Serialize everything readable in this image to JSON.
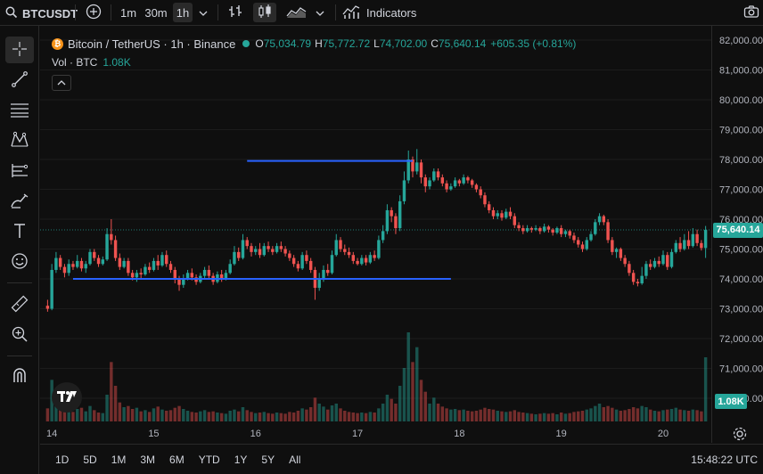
{
  "toolbar": {
    "symbol": "BTCUSDT",
    "intervals": [
      "1m",
      "30m",
      "1h"
    ],
    "active_interval": "1h",
    "indicators_label": "Indicators"
  },
  "legend": {
    "title": "Bitcoin / TetherUS · 1h · Binance",
    "coin_glyph": "₿",
    "o_label": "O",
    "o_value": "75,034.79",
    "h_label": "H",
    "h_value": "75,772.72",
    "l_label": "L",
    "l_value": "74,702.00",
    "c_label": "C",
    "c_value": "75,640.14",
    "change": "+605.35 (+0.81%)",
    "volume_label": "Vol · BTC",
    "volume_value": "1.08K"
  },
  "price_axis": {
    "ticks": [
      "82,000.00",
      "81,000.00",
      "80,000.00",
      "79,000.00",
      "78,000.00",
      "77,000.00",
      "76,000.00",
      "75,000.00",
      "74,000.00",
      "73,000.00",
      "72,000.00",
      "71,000.00",
      "70,000.00"
    ],
    "current_price_tag": "75,640.14",
    "volume_tag": "1.08K"
  },
  "time_axis": {
    "labels": [
      "14",
      "15",
      "16",
      "17",
      "18",
      "19",
      "20"
    ]
  },
  "bottom": {
    "ranges": [
      "1D",
      "5D",
      "1M",
      "3M",
      "6M",
      "YTD",
      "1Y",
      "5Y",
      "All"
    ],
    "clock": "15:48:22 UTC"
  },
  "icons": {
    "sidebar": [
      "crosshair-icon",
      "trend-line-icon",
      "fib-retracement-icon",
      "pattern-icon",
      "prediction-icon",
      "brush-icon",
      "text-icon",
      "emoji-icon",
      "ruler-icon",
      "zoom-in-icon",
      "magnet-icon"
    ]
  },
  "colors": {
    "up": "#26a69a",
    "down": "#ef5350",
    "drawn_line": "#2962ff",
    "background": "#0f0f0f"
  },
  "chart_data": {
    "type": "candlestick",
    "symbol": "BTCUSDT",
    "timeframe": "1h",
    "ylim": [
      69800,
      82300
    ],
    "x_day_labels": [
      "14",
      "15",
      "16",
      "17",
      "18",
      "19",
      "20"
    ],
    "candles": [
      {
        "o": 73100,
        "c": 73000,
        "h": 73300,
        "l": 72900,
        "v": 220
      },
      {
        "o": 73000,
        "c": 74300,
        "h": 74500,
        "l": 72950,
        "v": 700
      },
      {
        "o": 74300,
        "c": 74700,
        "h": 74900,
        "l": 74200,
        "v": 300
      },
      {
        "o": 74700,
        "c": 74400,
        "h": 74800,
        "l": 74300,
        "v": 250
      },
      {
        "o": 74400,
        "c": 74200,
        "h": 74500,
        "l": 74050,
        "v": 200
      },
      {
        "o": 74200,
        "c": 74500,
        "h": 74650,
        "l": 74100,
        "v": 180
      },
      {
        "o": 74500,
        "c": 74400,
        "h": 74600,
        "l": 74300,
        "v": 160
      },
      {
        "o": 74400,
        "c": 74600,
        "h": 74800,
        "l": 74350,
        "v": 210
      },
      {
        "o": 74600,
        "c": 74350,
        "h": 74700,
        "l": 74250,
        "v": 230
      },
      {
        "o": 74350,
        "c": 74500,
        "h": 74600,
        "l": 74200,
        "v": 170
      },
      {
        "o": 74500,
        "c": 74900,
        "h": 75000,
        "l": 74450,
        "v": 260
      },
      {
        "o": 74900,
        "c": 74700,
        "h": 75000,
        "l": 74600,
        "v": 190
      },
      {
        "o": 74700,
        "c": 74500,
        "h": 74800,
        "l": 74400,
        "v": 150
      },
      {
        "o": 74500,
        "c": 74650,
        "h": 74750,
        "l": 74450,
        "v": 140
      },
      {
        "o": 74650,
        "c": 75500,
        "h": 75700,
        "l": 74600,
        "v": 450
      },
      {
        "o": 75500,
        "c": 75300,
        "h": 76000,
        "l": 75150,
        "v": 1000
      },
      {
        "o": 75300,
        "c": 74700,
        "h": 75450,
        "l": 74600,
        "v": 600
      },
      {
        "o": 74700,
        "c": 74400,
        "h": 74850,
        "l": 74300,
        "v": 320
      },
      {
        "o": 74400,
        "c": 74600,
        "h": 74700,
        "l": 74350,
        "v": 240
      },
      {
        "o": 74600,
        "c": 74200,
        "h": 74700,
        "l": 74100,
        "v": 260
      },
      {
        "o": 74200,
        "c": 74050,
        "h": 74300,
        "l": 73950,
        "v": 210
      },
      {
        "o": 74050,
        "c": 74200,
        "h": 74300,
        "l": 73900,
        "v": 230
      },
      {
        "o": 74200,
        "c": 74150,
        "h": 74350,
        "l": 74000,
        "v": 170
      },
      {
        "o": 74150,
        "c": 74400,
        "h": 74500,
        "l": 74100,
        "v": 190
      },
      {
        "o": 74400,
        "c": 74300,
        "h": 74550,
        "l": 74200,
        "v": 160
      },
      {
        "o": 74300,
        "c": 74600,
        "h": 74700,
        "l": 74250,
        "v": 220
      },
      {
        "o": 74600,
        "c": 74450,
        "h": 74800,
        "l": 74300,
        "v": 250
      },
      {
        "o": 74450,
        "c": 74800,
        "h": 74900,
        "l": 74400,
        "v": 200
      },
      {
        "o": 74800,
        "c": 74500,
        "h": 74950,
        "l": 74400,
        "v": 180
      },
      {
        "o": 74500,
        "c": 74300,
        "h": 74600,
        "l": 74200,
        "v": 190
      },
      {
        "o": 74300,
        "c": 74000,
        "h": 74400,
        "l": 73850,
        "v": 230
      },
      {
        "o": 74000,
        "c": 73800,
        "h": 74100,
        "l": 73600,
        "v": 260
      },
      {
        "o": 73800,
        "c": 74000,
        "h": 74150,
        "l": 73700,
        "v": 210
      },
      {
        "o": 74000,
        "c": 74200,
        "h": 74300,
        "l": 73950,
        "v": 180
      },
      {
        "o": 74200,
        "c": 74050,
        "h": 74350,
        "l": 73950,
        "v": 160
      },
      {
        "o": 74050,
        "c": 73900,
        "h": 74150,
        "l": 73800,
        "v": 150
      },
      {
        "o": 73900,
        "c": 74100,
        "h": 74200,
        "l": 73850,
        "v": 170
      },
      {
        "o": 74100,
        "c": 74300,
        "h": 74400,
        "l": 74000,
        "v": 190
      },
      {
        "o": 74300,
        "c": 74100,
        "h": 74450,
        "l": 74000,
        "v": 160
      },
      {
        "o": 74100,
        "c": 73900,
        "h": 74200,
        "l": 73800,
        "v": 170
      },
      {
        "o": 73900,
        "c": 74150,
        "h": 74250,
        "l": 73850,
        "v": 150
      },
      {
        "o": 74150,
        "c": 74000,
        "h": 74300,
        "l": 73900,
        "v": 140
      },
      {
        "o": 74000,
        "c": 74200,
        "h": 74300,
        "l": 73950,
        "v": 130
      },
      {
        "o": 74200,
        "c": 74500,
        "h": 74650,
        "l": 74150,
        "v": 180
      },
      {
        "o": 74500,
        "c": 74900,
        "h": 75100,
        "l": 74450,
        "v": 200
      },
      {
        "o": 74900,
        "c": 74700,
        "h": 75050,
        "l": 74600,
        "v": 170
      },
      {
        "o": 74700,
        "c": 75300,
        "h": 75500,
        "l": 74650,
        "v": 240
      },
      {
        "o": 75300,
        "c": 75100,
        "h": 75400,
        "l": 75000,
        "v": 190
      },
      {
        "o": 75100,
        "c": 74900,
        "h": 75200,
        "l": 74750,
        "v": 160
      },
      {
        "o": 74900,
        "c": 75000,
        "h": 75100,
        "l": 74800,
        "v": 140
      },
      {
        "o": 75000,
        "c": 74800,
        "h": 75200,
        "l": 74700,
        "v": 150
      },
      {
        "o": 74800,
        "c": 75100,
        "h": 75200,
        "l": 74750,
        "v": 160
      },
      {
        "o": 75100,
        "c": 75000,
        "h": 75250,
        "l": 74900,
        "v": 140
      },
      {
        "o": 75000,
        "c": 74900,
        "h": 75100,
        "l": 74800,
        "v": 130
      },
      {
        "o": 74900,
        "c": 75100,
        "h": 75200,
        "l": 74850,
        "v": 150
      },
      {
        "o": 75100,
        "c": 75000,
        "h": 75250,
        "l": 74900,
        "v": 140
      },
      {
        "o": 75000,
        "c": 74850,
        "h": 75100,
        "l": 74750,
        "v": 130
      },
      {
        "o": 74850,
        "c": 74700,
        "h": 74950,
        "l": 74600,
        "v": 160
      },
      {
        "o": 74700,
        "c": 74500,
        "h": 74800,
        "l": 74400,
        "v": 150
      },
      {
        "o": 74500,
        "c": 74350,
        "h": 74600,
        "l": 74250,
        "v": 180
      },
      {
        "o": 74350,
        "c": 74800,
        "h": 74900,
        "l": 74300,
        "v": 220
      },
      {
        "o": 74800,
        "c": 74600,
        "h": 74950,
        "l": 74500,
        "v": 200
      },
      {
        "o": 74600,
        "c": 74300,
        "h": 74700,
        "l": 74200,
        "v": 240
      },
      {
        "o": 74300,
        "c": 73700,
        "h": 74400,
        "l": 73300,
        "v": 400
      },
      {
        "o": 73700,
        "c": 74000,
        "h": 74200,
        "l": 73600,
        "v": 300
      },
      {
        "o": 74000,
        "c": 74300,
        "h": 74450,
        "l": 73900,
        "v": 250
      },
      {
        "o": 74300,
        "c": 74200,
        "h": 74500,
        "l": 74100,
        "v": 200
      },
      {
        "o": 74200,
        "c": 74800,
        "h": 74950,
        "l": 74150,
        "v": 270
      },
      {
        "o": 74800,
        "c": 75300,
        "h": 75500,
        "l": 74750,
        "v": 300
      },
      {
        "o": 75300,
        "c": 75000,
        "h": 75400,
        "l": 74900,
        "v": 220
      },
      {
        "o": 75000,
        "c": 74900,
        "h": 75150,
        "l": 74800,
        "v": 180
      },
      {
        "o": 74900,
        "c": 74800,
        "h": 75050,
        "l": 74700,
        "v": 160
      },
      {
        "o": 74800,
        "c": 74600,
        "h": 74900,
        "l": 74500,
        "v": 150
      },
      {
        "o": 74600,
        "c": 74500,
        "h": 74700,
        "l": 74450,
        "v": 140
      },
      {
        "o": 74500,
        "c": 74700,
        "h": 74800,
        "l": 74450,
        "v": 150
      },
      {
        "o": 74700,
        "c": 74550,
        "h": 74800,
        "l": 74450,
        "v": 140
      },
      {
        "o": 74550,
        "c": 74800,
        "h": 74900,
        "l": 74500,
        "v": 160
      },
      {
        "o": 74800,
        "c": 74700,
        "h": 74950,
        "l": 74600,
        "v": 150
      },
      {
        "o": 74700,
        "c": 75300,
        "h": 75450,
        "l": 74650,
        "v": 220
      },
      {
        "o": 75300,
        "c": 75600,
        "h": 75800,
        "l": 75200,
        "v": 300
      },
      {
        "o": 75600,
        "c": 76300,
        "h": 76500,
        "l": 75500,
        "v": 450
      },
      {
        "o": 76300,
        "c": 76100,
        "h": 76400,
        "l": 75900,
        "v": 380
      },
      {
        "o": 76100,
        "c": 75700,
        "h": 76200,
        "l": 75500,
        "v": 300
      },
      {
        "o": 75700,
        "c": 76600,
        "h": 76800,
        "l": 75600,
        "v": 600
      },
      {
        "o": 76600,
        "c": 77300,
        "h": 77600,
        "l": 76500,
        "v": 900
      },
      {
        "o": 77300,
        "c": 78000,
        "h": 78300,
        "l": 77200,
        "v": 1500
      },
      {
        "o": 78000,
        "c": 77600,
        "h": 78100,
        "l": 77400,
        "v": 1000
      },
      {
        "o": 77600,
        "c": 77900,
        "h": 78350,
        "l": 77500,
        "v": 1250
      },
      {
        "o": 77900,
        "c": 77400,
        "h": 78000,
        "l": 77200,
        "v": 700
      },
      {
        "o": 77400,
        "c": 77100,
        "h": 77500,
        "l": 76900,
        "v": 500
      },
      {
        "o": 77100,
        "c": 77300,
        "h": 77400,
        "l": 77000,
        "v": 300
      },
      {
        "o": 77300,
        "c": 77600,
        "h": 77700,
        "l": 77250,
        "v": 400
      },
      {
        "o": 77600,
        "c": 77400,
        "h": 77700,
        "l": 77300,
        "v": 300
      },
      {
        "o": 77400,
        "c": 77200,
        "h": 77500,
        "l": 77100,
        "v": 250
      },
      {
        "o": 77200,
        "c": 77000,
        "h": 77300,
        "l": 76900,
        "v": 220
      },
      {
        "o": 77000,
        "c": 77100,
        "h": 77200,
        "l": 76950,
        "v": 200
      },
      {
        "o": 77100,
        "c": 77300,
        "h": 77400,
        "l": 77050,
        "v": 210
      },
      {
        "o": 77300,
        "c": 77200,
        "h": 77350,
        "l": 77100,
        "v": 190
      },
      {
        "o": 77200,
        "c": 77400,
        "h": 77500,
        "l": 77150,
        "v": 200
      },
      {
        "o": 77400,
        "c": 77300,
        "h": 77450,
        "l": 77200,
        "v": 180
      },
      {
        "o": 77300,
        "c": 77150,
        "h": 77350,
        "l": 77050,
        "v": 170
      },
      {
        "o": 77150,
        "c": 77000,
        "h": 77200,
        "l": 76900,
        "v": 180
      },
      {
        "o": 77000,
        "c": 76800,
        "h": 77100,
        "l": 76700,
        "v": 200
      },
      {
        "o": 76800,
        "c": 76500,
        "h": 76900,
        "l": 76400,
        "v": 230
      },
      {
        "o": 76500,
        "c": 76300,
        "h": 76600,
        "l": 76200,
        "v": 210
      },
      {
        "o": 76300,
        "c": 76100,
        "h": 76400,
        "l": 76000,
        "v": 200
      },
      {
        "o": 76100,
        "c": 76200,
        "h": 76300,
        "l": 76000,
        "v": 180
      },
      {
        "o": 76200,
        "c": 76050,
        "h": 76300,
        "l": 75950,
        "v": 170
      },
      {
        "o": 76050,
        "c": 76250,
        "h": 76350,
        "l": 76000,
        "v": 160
      },
      {
        "o": 76250,
        "c": 76100,
        "h": 76400,
        "l": 76000,
        "v": 170
      },
      {
        "o": 76100,
        "c": 75800,
        "h": 76200,
        "l": 75700,
        "v": 190
      },
      {
        "o": 75800,
        "c": 75700,
        "h": 75900,
        "l": 75600,
        "v": 160
      },
      {
        "o": 75700,
        "c": 75600,
        "h": 75800,
        "l": 75500,
        "v": 150
      },
      {
        "o": 75600,
        "c": 75700,
        "h": 75800,
        "l": 75550,
        "v": 140
      },
      {
        "o": 75700,
        "c": 75650,
        "h": 75750,
        "l": 75550,
        "v": 130
      },
      {
        "o": 75650,
        "c": 75700,
        "h": 75800,
        "l": 75600,
        "v": 120
      },
      {
        "o": 75700,
        "c": 75600,
        "h": 75750,
        "l": 75500,
        "v": 130
      },
      {
        "o": 75600,
        "c": 75750,
        "h": 75850,
        "l": 75550,
        "v": 140
      },
      {
        "o": 75750,
        "c": 75650,
        "h": 75800,
        "l": 75550,
        "v": 130
      },
      {
        "o": 75650,
        "c": 75550,
        "h": 75700,
        "l": 75450,
        "v": 140
      },
      {
        "o": 75550,
        "c": 75700,
        "h": 75750,
        "l": 75500,
        "v": 120
      },
      {
        "o": 75700,
        "c": 75500,
        "h": 75800,
        "l": 75400,
        "v": 150
      },
      {
        "o": 75500,
        "c": 75600,
        "h": 75650,
        "l": 75400,
        "v": 130
      },
      {
        "o": 75600,
        "c": 75450,
        "h": 75650,
        "l": 75350,
        "v": 140
      },
      {
        "o": 75450,
        "c": 75300,
        "h": 75550,
        "l": 75200,
        "v": 160
      },
      {
        "o": 75300,
        "c": 75150,
        "h": 75400,
        "l": 75050,
        "v": 170
      },
      {
        "o": 75150,
        "c": 75000,
        "h": 75250,
        "l": 74900,
        "v": 180
      },
      {
        "o": 75000,
        "c": 75300,
        "h": 75400,
        "l": 74950,
        "v": 200
      },
      {
        "o": 75300,
        "c": 75500,
        "h": 75600,
        "l": 75250,
        "v": 220
      },
      {
        "o": 75500,
        "c": 75900,
        "h": 76000,
        "l": 75450,
        "v": 260
      },
      {
        "o": 75900,
        "c": 76100,
        "h": 76200,
        "l": 75800,
        "v": 300
      },
      {
        "o": 76100,
        "c": 75900,
        "h": 76150,
        "l": 75800,
        "v": 240
      },
      {
        "o": 75900,
        "c": 75300,
        "h": 76000,
        "l": 75200,
        "v": 260
      },
      {
        "o": 75300,
        "c": 74900,
        "h": 75400,
        "l": 74800,
        "v": 230
      },
      {
        "o": 74900,
        "c": 75000,
        "h": 75050,
        "l": 74700,
        "v": 200
      },
      {
        "o": 75000,
        "c": 74700,
        "h": 75050,
        "l": 74600,
        "v": 180
      },
      {
        "o": 74700,
        "c": 74500,
        "h": 74800,
        "l": 74400,
        "v": 190
      },
      {
        "o": 74500,
        "c": 74200,
        "h": 74600,
        "l": 74100,
        "v": 210
      },
      {
        "o": 74200,
        "c": 73900,
        "h": 74300,
        "l": 73800,
        "v": 240
      },
      {
        "o": 73900,
        "c": 73850,
        "h": 74000,
        "l": 73750,
        "v": 220
      },
      {
        "o": 73850,
        "c": 74100,
        "h": 74400,
        "l": 73800,
        "v": 260
      },
      {
        "o": 74100,
        "c": 74500,
        "h": 74600,
        "l": 74000,
        "v": 240
      },
      {
        "o": 74500,
        "c": 74400,
        "h": 74650,
        "l": 74300,
        "v": 200
      },
      {
        "o": 74400,
        "c": 74600,
        "h": 74700,
        "l": 74350,
        "v": 180
      },
      {
        "o": 74600,
        "c": 74500,
        "h": 74750,
        "l": 74400,
        "v": 170
      },
      {
        "o": 74500,
        "c": 74800,
        "h": 74950,
        "l": 74450,
        "v": 190
      },
      {
        "o": 74800,
        "c": 74400,
        "h": 74900,
        "l": 74300,
        "v": 200
      },
      {
        "o": 74400,
        "c": 74900,
        "h": 75000,
        "l": 74350,
        "v": 210
      },
      {
        "o": 74900,
        "c": 75200,
        "h": 75300,
        "l": 74850,
        "v": 230
      },
      {
        "o": 75200,
        "c": 75000,
        "h": 75400,
        "l": 74900,
        "v": 200
      },
      {
        "o": 75000,
        "c": 75300,
        "h": 75500,
        "l": 74950,
        "v": 190
      },
      {
        "o": 75300,
        "c": 75100,
        "h": 75600,
        "l": 75000,
        "v": 180
      },
      {
        "o": 75100,
        "c": 75500,
        "h": 75700,
        "l": 75050,
        "v": 200
      },
      {
        "o": 75500,
        "c": 75200,
        "h": 75650,
        "l": 75100,
        "v": 190
      },
      {
        "o": 75200,
        "c": 75034.79,
        "h": 75300,
        "l": 74950,
        "v": 170
      },
      {
        "o": 75034.79,
        "c": 75640.14,
        "h": 75772.72,
        "l": 74702,
        "v": 1080
      }
    ],
    "horizontal_lines": [
      {
        "price": 77950,
        "from_candle": 47,
        "to_candle": 86
      },
      {
        "price": 74000,
        "from_candle": 6,
        "to_candle": 95
      }
    ]
  }
}
